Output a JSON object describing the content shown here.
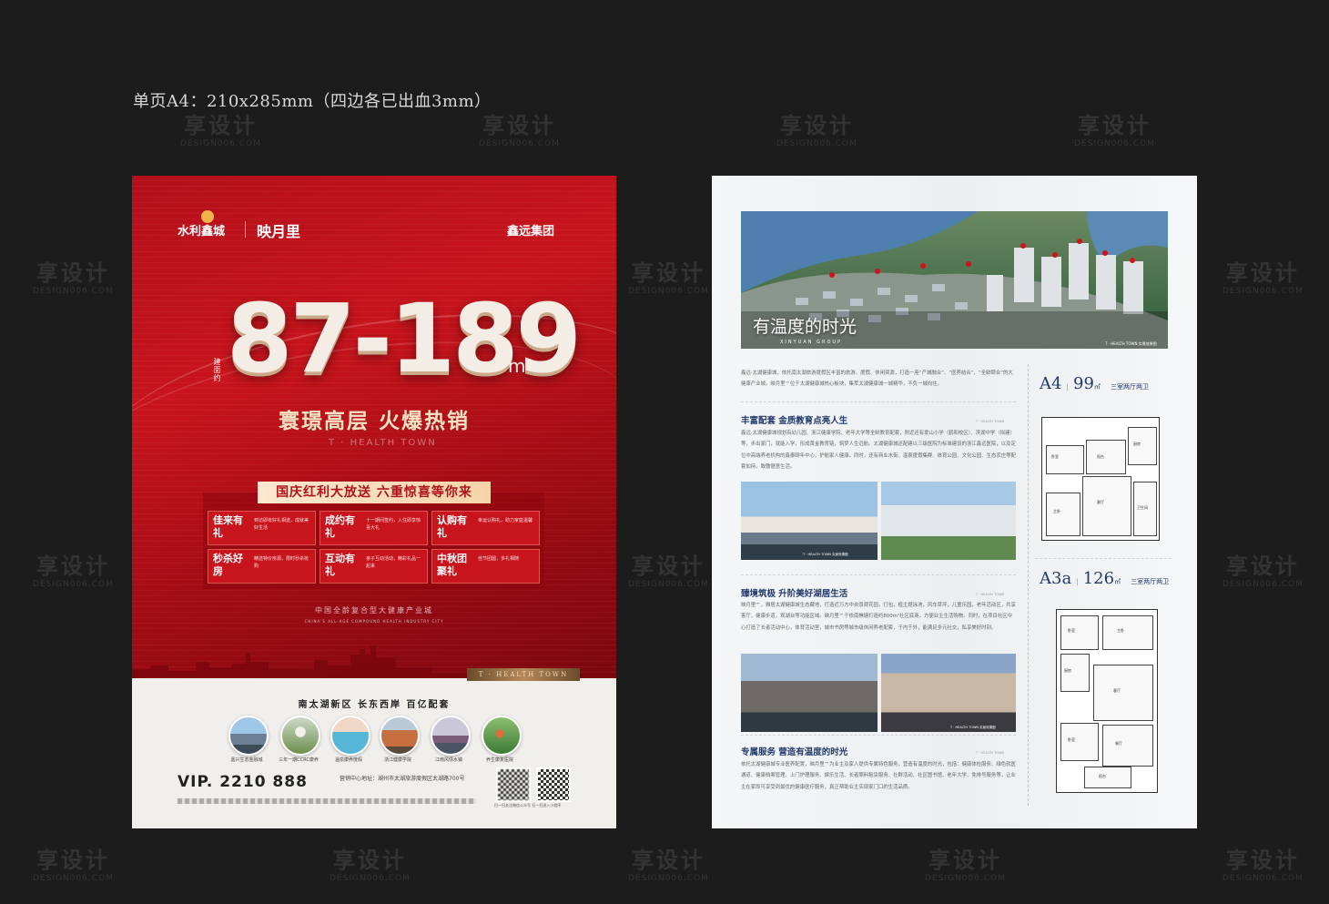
{
  "spec_label": "单页A4：210x285mm（四边各已出血3mm）",
  "watermark": {
    "main": "享设计",
    "sub": "DESIGN006.COM"
  },
  "front": {
    "logos": {
      "developer": "水利鑫城",
      "project": "映月里",
      "group": "鑫远集团"
    },
    "area_label": "建面约",
    "area_range": "87-189",
    "area_unit": "m²",
    "slogan": "寰璟高层 火爆热销",
    "brand_en": "T · HEALTH TOWN",
    "promo_banner": "国庆红利大放送 六重惊喜等你来",
    "gifts": [
      {
        "title": "佳来有礼",
        "desc": "到访即有好礼相送，成就美好生活"
      },
      {
        "title": "成约有礼",
        "desc": "十一期间签约，入住即享惊喜大礼"
      },
      {
        "title": "认购有礼",
        "desc": "幸运认购礼，助力家庭温馨"
      },
      {
        "title": "秒杀好房",
        "desc": "精选特价房源，限时秒杀抢购"
      },
      {
        "title": "互动有礼",
        "desc": "亲子互动活动，精彩礼品一起来"
      },
      {
        "title": "中秋团聚礼",
        "desc": "佳节团圆，多礼相随"
      }
    ],
    "tagline_cn": "中国全龄复合型大健康产业城",
    "tagline_en": "CHINA'S ALL-AGE COMPOUND HEALTH INDUSTRY CITY",
    "gold_label": "T · HEALTH TOWN",
    "location": "南太湖新区 长东西岸 百亿配套",
    "features": [
      "嘉兴生态金融城",
      "三年一期CCRC康养",
      "温泉康养度假",
      "浙江健康学院",
      "江南风情水镇",
      "养生康复医院"
    ],
    "vip_label": "VIP.",
    "vip_phone": "2210 888",
    "address": "营销中心地址：湖州市太湖旅游度假区太湖路700号",
    "qr_caption": "扫一扫关注微信公众号 扫一扫进入小程序"
  },
  "back": {
    "hero_title": "有温度的时光",
    "hero_sub": "XINYUAN GROUP",
    "hero_tag": "T · HEALTH TOWN 实景效果图",
    "intro": "鑫远·太湖健康城，依托南太湖旅游度假区丰富的旅游、度假、休闲资源，打造一座“产城融合”、“医养结合”、“全龄颐合”的大健康产业城。映月里™位于太湖健康城核心板块，集萃太湖健康城一城精华，不负一城向往。",
    "sections": [
      {
        "title": "丰富配套 金质教育点亮人生",
        "tag": "T · HEALTH TOWN",
        "text": "鑫远·太湖健康城规划有幼儿园、浙江健康学院、老年大学等全龄教育配套，附近还有爱山小学（鹤和校区）、滨湖中学（拟建）等，步出家门，就能入学，形成黄金教育链，筑梦人生远航。太湖健康城还配建以三级医院为标准建设的浙江鑫远医院，以及定位中高端养老机构的鑫泰颐年中心，护航家人健康。同时，还有商业水街、温泉度假集群、体育公园、文化公园、生态农庄等配套加持，致敬惬意生活。",
        "photo_caption": "T · HEALTH TOWN 实景效果图"
      },
      {
        "title": "臻境筑极 升阶美好湖居生活",
        "tag": "T · HEALTH TOWN",
        "text": "映月里™，雅居太湖健康城生态藏地，打造近万方中央景观花园，打包，植主题泳池，风车草坪，儿童乐园，老年活动区，共享客厅，健康步道，观湖台等功能区域。映月里™于依南樵塘打造约800m²社区底商，方便业主生活购物。同时，在项目社区中心打造了长者活动中心，体育活动室，城市书房等城市级休闲养老配套，于内于外，能满足多元社交，私享美好时刻。",
        "photo_caption": "T · HEALTH TOWN 实景效果图"
      },
      {
        "title": "专属服务 营造有温度的时光",
        "tag": "T · HEALTH TOWN",
        "text": "依托太湖健康城专业医养配置，映月里™为业主及家人提供专属特色服务，营造有温度的时光，包括：健康体检服务、绿色就医通道、健康档案管理、上门护理服务、娱乐生活、长者照料租赁服务、社群活动、社区图书馆、老年大学、免排号服务等，让业主在家即可享受到最优的健康医疗服务，真正帮助业主实现家门口的生活品质。"
      }
    ],
    "plans": [
      {
        "code": "A4",
        "size": "99",
        "unit": "㎡",
        "layout": "三室两厅两卫"
      },
      {
        "code": "A3a",
        "size": "126",
        "unit": "㎡",
        "layout": "三室两厅两卫"
      }
    ],
    "room_labels": [
      "卧室",
      "客厅",
      "餐厅",
      "厨房",
      "卫生间",
      "阳台",
      "主卧",
      "入户"
    ]
  }
}
